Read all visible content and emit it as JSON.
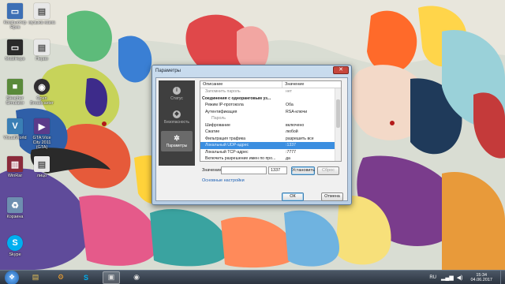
{
  "desktop": {
    "icons_left": [
      {
        "label": "Компьютер Ярик",
        "icon": "computer-icon",
        "color": "#3d6fb5"
      },
      {
        "label": "MobiHops",
        "icon": "app-icon",
        "color": "#2a2a2a"
      },
      {
        "label": "Bleacher Simulator",
        "icon": "minecraft-icon",
        "color": "#5a8a3a"
      },
      {
        "label": "VisualWorld",
        "icon": "vw-icon",
        "color": "#3a7fb5"
      },
      {
        "label": "WinRar",
        "icon": "archive-icon",
        "color": "#8a2a3a"
      },
      {
        "label": "Корзина",
        "icon": "recycle-bin-icon",
        "color": "#6e8fb0"
      },
      {
        "label": "Skype",
        "icon": "skype-icon",
        "color": "#00aff0"
      }
    ],
    "icons_right": [
      {
        "label": "музыка мама",
        "icon": "document-icon",
        "color": "#e8e8e8"
      },
      {
        "label": "Перво",
        "icon": "document-icon",
        "color": "#e8e8e8"
      },
      {
        "label": "Open Broadcaster",
        "icon": "obs-icon",
        "color": "#302e31"
      },
      {
        "label": "GTA:Vice City 2011 (GTA)",
        "icon": "game-icon",
        "color": "#5b3b8a"
      },
      {
        "label": "лицо",
        "icon": "document-icon",
        "color": "#e8e8e8"
      }
    ]
  },
  "dialog": {
    "title": "Параметры",
    "close": "✕",
    "sidebar": [
      {
        "label": "Статус",
        "icon": "info-icon",
        "glyph": "i",
        "active": false
      },
      {
        "label": "Безопасность",
        "icon": "shield-icon",
        "glyph": "◆",
        "active": false
      },
      {
        "label": "Параметры",
        "icon": "gear-icon",
        "glyph": "✲",
        "active": true
      }
    ],
    "table": {
      "headers": [
        "Описание",
        "Значение"
      ],
      "rows": [
        {
          "name": "Запомнить пароль",
          "value": "нет",
          "kind": "grey"
        },
        {
          "name": "Соединения с одноранговым уз...",
          "value": "",
          "kind": "group"
        },
        {
          "name": "Режим IP-протокола",
          "value": "Оба",
          "kind": "normal"
        },
        {
          "name": "Аутентификация",
          "value": "RSA-ключи",
          "kind": "normal"
        },
        {
          "name": "Пароль",
          "value": "",
          "kind": "grey-sub"
        },
        {
          "name": "Шифрование",
          "value": "включено",
          "kind": "normal"
        },
        {
          "name": "Сжатие",
          "value": "любой",
          "kind": "normal"
        },
        {
          "name": "Фильтрация трафика",
          "value": "разрешить все",
          "kind": "normal"
        },
        {
          "name": "Локальный UDP-адрес",
          "value": ":1337",
          "kind": "selected"
        },
        {
          "name": "Локальный TCP-адрес",
          "value": ":7777",
          "kind": "normal"
        },
        {
          "name": "Включить разрешение имен по про...",
          "value": "да",
          "kind": "normal"
        }
      ]
    },
    "value_label": "Значение",
    "value_input": "",
    "port_value": "1337",
    "apply_label": "Установить",
    "reset_label": "Сброс",
    "basic_link": "Основные настройки",
    "ok_label": "ОК",
    "cancel_label": "Отмена"
  },
  "taskbar": {
    "start_icon": "windows-start-icon",
    "apps": [
      {
        "icon": "explorer-icon",
        "glyph": "▤",
        "color": "#e8c25a"
      },
      {
        "icon": "settings-app-icon",
        "glyph": "⚙",
        "color": "#f0a030"
      },
      {
        "icon": "skype-icon",
        "glyph": "S",
        "color": "#00aff0"
      },
      {
        "icon": "network-app-icon",
        "glyph": "▣",
        "color": "#dcdcdc"
      },
      {
        "icon": "obs-icon",
        "glyph": "◉",
        "color": "#e0e0e0"
      }
    ],
    "lang": "RU",
    "time": "15:34",
    "date": "04.06.2017"
  }
}
